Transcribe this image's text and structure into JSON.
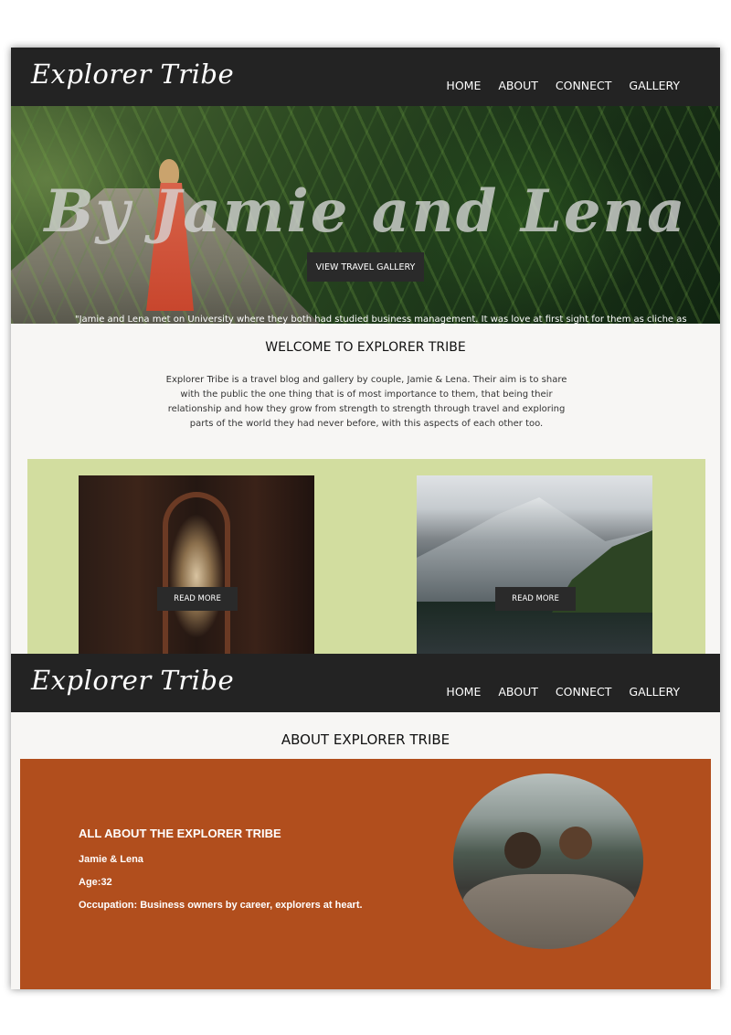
{
  "brand": "Explorer Tribe",
  "nav": [
    "HOME",
    "ABOUT",
    "CONNECT",
    "GALLERY"
  ],
  "hero": {
    "title": "By Jamie and Lena",
    "button": "VIEW TRAVEL GALLERY"
  },
  "welcome": {
    "title": "WELCOME TO EXPLORER TRIBE",
    "text": "Explorer Tribe is a travel blog and gallery by couple, Jamie & Lena. Their aim is to share with the public the one thing that is of most importance to them, that being their relationship and how they grow from strength to strength through travel and exploring parts of the world they had never before, with this aspects of each other too."
  },
  "cards": [
    {
      "button": "READ MORE"
    },
    {
      "button": "READ MORE"
    }
  ],
  "about": {
    "title": "ABOUT EXPLORER TRIBE",
    "heading": "ALL ABOUT THE EXPLORER TRIBE",
    "names": "Jamie & Lena",
    "age": "Age:32",
    "occupation": "Occupation: Business owners by career, explorers at heart.",
    "quote": "\"Jamie and Lena met on University where they both had studied business management. It was love at first sight for them as cliche as"
  },
  "colors": {
    "navbar": "#232323",
    "cards_bg": "#d2dd9f",
    "about_bg": "#b14e1d",
    "button_bg": "#2a2a2a"
  }
}
